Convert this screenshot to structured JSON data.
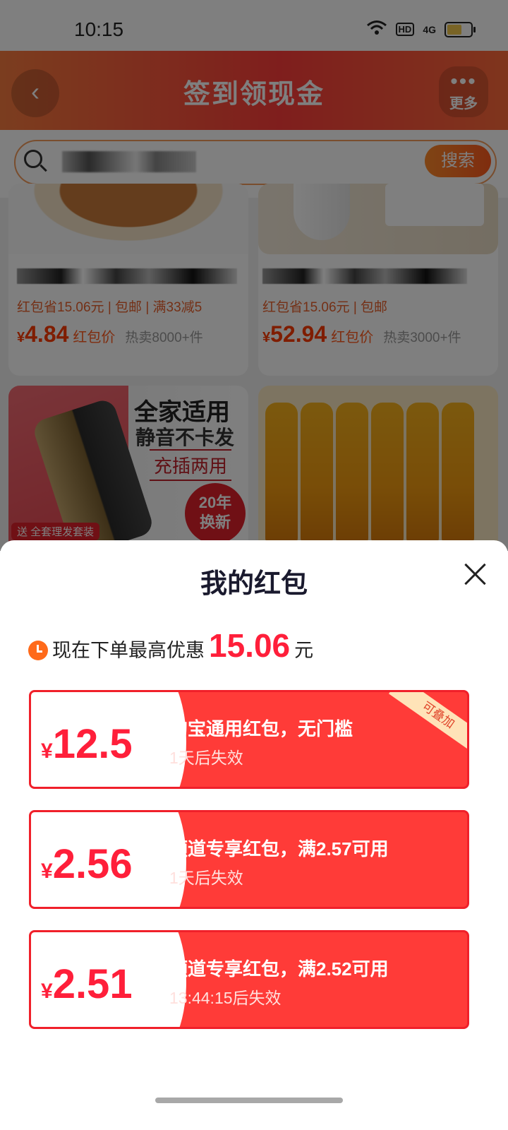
{
  "status_bar": {
    "time": "10:15",
    "hd": "HD",
    "network": "4G"
  },
  "header": {
    "title": "签到领现金",
    "back_icon": "‹",
    "more_icon": "•••",
    "more_label": "更多"
  },
  "search": {
    "button_label": "搜索"
  },
  "products": [
    {
      "tags": "红包省15.06元 | 包邮 | 满33减5",
      "yen": "¥",
      "price": "4.84",
      "price_label": "红包价",
      "sold": "热卖8000+件"
    },
    {
      "tags": "红包省15.06元 | 包邮",
      "yen": "¥",
      "price": "52.94",
      "price_label": "红包价",
      "sold": "热卖3000+件"
    }
  ],
  "promo_card": {
    "line1": "全家适用",
    "line2": "静音不卡发",
    "line3": "充插两用",
    "badge_line1": "20年",
    "badge_line2": "换新",
    "gift_tag": "送 全套理发套装"
  },
  "sheet": {
    "title": "我的红包",
    "promo_prefix": "现在下单最高优惠",
    "promo_amount": "15.06",
    "promo_suffix": "元",
    "coupons": [
      {
        "yen": "¥",
        "amount": "12.5",
        "title": "淘宝通用红包，无门槛",
        "expire": "1天后失效",
        "ribbon": "可叠加"
      },
      {
        "yen": "¥",
        "amount": "2.56",
        "title": "频道专享红包，满2.57可用",
        "expire": "1天后失效"
      },
      {
        "yen": "¥",
        "amount": "2.51",
        "title": "频道专享红包，满2.52可用",
        "expire": "13:44:15后失效"
      }
    ]
  },
  "colors": {
    "accent": "#ff3b38",
    "price": "#ff3b00",
    "header": "#ff5a3a"
  }
}
